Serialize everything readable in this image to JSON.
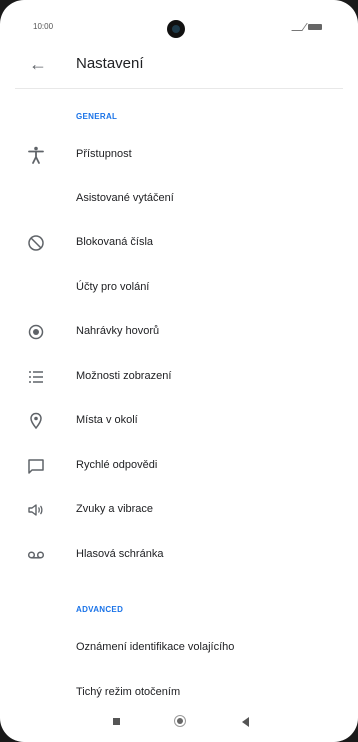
{
  "status_bar": {
    "time": "10:00"
  },
  "app_bar": {
    "title": "Nastavení"
  },
  "sections": [
    {
      "header": "GENERAL"
    },
    {
      "header": "ADVANCED"
    }
  ],
  "items": [
    {
      "label": "Přístupnost",
      "icon": "accessibility-icon"
    },
    {
      "label": "Asistované vytáčení",
      "icon": ""
    },
    {
      "label": "Blokovaná čísla",
      "icon": "block-icon"
    },
    {
      "label": "Účty pro volání",
      "icon": ""
    },
    {
      "label": "Nahrávky hovorů",
      "icon": "record-icon"
    },
    {
      "label": "Možnosti zobrazení",
      "icon": "list-icon"
    },
    {
      "label": "Místa v okolí",
      "icon": "location-icon"
    },
    {
      "label": "Rychlé odpovědi",
      "icon": "message-icon"
    },
    {
      "label": "Zvuky a vibrace",
      "icon": "sound-icon"
    },
    {
      "label": "Hlasová schránka",
      "icon": "voicemail-icon"
    },
    {
      "label": "Oznámení identifikace volajícího",
      "icon": ""
    },
    {
      "label": "Tichý režim otočením",
      "icon": ""
    }
  ],
  "colors": {
    "accent": "#1a73e8",
    "icon": "#5f6368",
    "text": "#202124"
  }
}
